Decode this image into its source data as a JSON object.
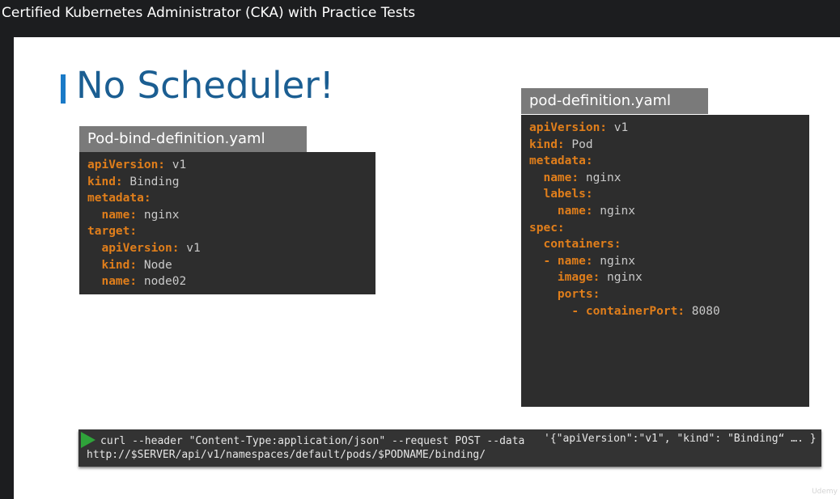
{
  "window": {
    "title": "Certified Kubernetes Administrator (CKA) with Practice Tests"
  },
  "slide": {
    "headline": "No Scheduler!",
    "bind_file": {
      "label": "Pod-bind-definition.yaml",
      "lines": [
        {
          "key": "apiVersion:",
          "value": " v1"
        },
        {
          "key": "kind:",
          "value": " Binding"
        },
        {
          "key": "metadata:",
          "value": ""
        },
        {
          "key": "  name:",
          "value": " nginx"
        },
        {
          "key": "target:",
          "value": ""
        },
        {
          "key": "  apiVersion:",
          "value": " v1"
        },
        {
          "key": "  kind:",
          "value": " Node"
        },
        {
          "key": "  name:",
          "value": " node02"
        }
      ]
    },
    "pod_file": {
      "label": "pod-definition.yaml",
      "lines": [
        {
          "key": "apiVersion:",
          "value": " v1"
        },
        {
          "key": "kind:",
          "value": " Pod"
        },
        {
          "key": "metadata:",
          "value": ""
        },
        {
          "key": "  name:",
          "value": " nginx"
        },
        {
          "key": "  labels:",
          "value": ""
        },
        {
          "key": "    name:",
          "value": " nginx"
        },
        {
          "key": "spec:",
          "value": ""
        },
        {
          "key": "  containers:",
          "value": ""
        },
        {
          "key": "  - name:",
          "value": " nginx"
        },
        {
          "key": "    image:",
          "value": " nginx"
        },
        {
          "key": "    ports:",
          "value": ""
        },
        {
          "key": "      - containerPort:",
          "value": " 8080"
        }
      ]
    },
    "command": {
      "line1": "curl --header \"Content-Type:application/json\" --request POST --data",
      "line1_data": "'{\"apiVersion\":\"v1\", \"kind\": \"Binding“ …. }",
      "line2": "http://$SERVER/api/v1/namespaces/default/pods/$PODNAME/binding/"
    },
    "watermark": "Udemy"
  },
  "colors": {
    "yaml_key": "#e07e1b",
    "headline": "#1b5e92",
    "play": "#2fa33a"
  }
}
